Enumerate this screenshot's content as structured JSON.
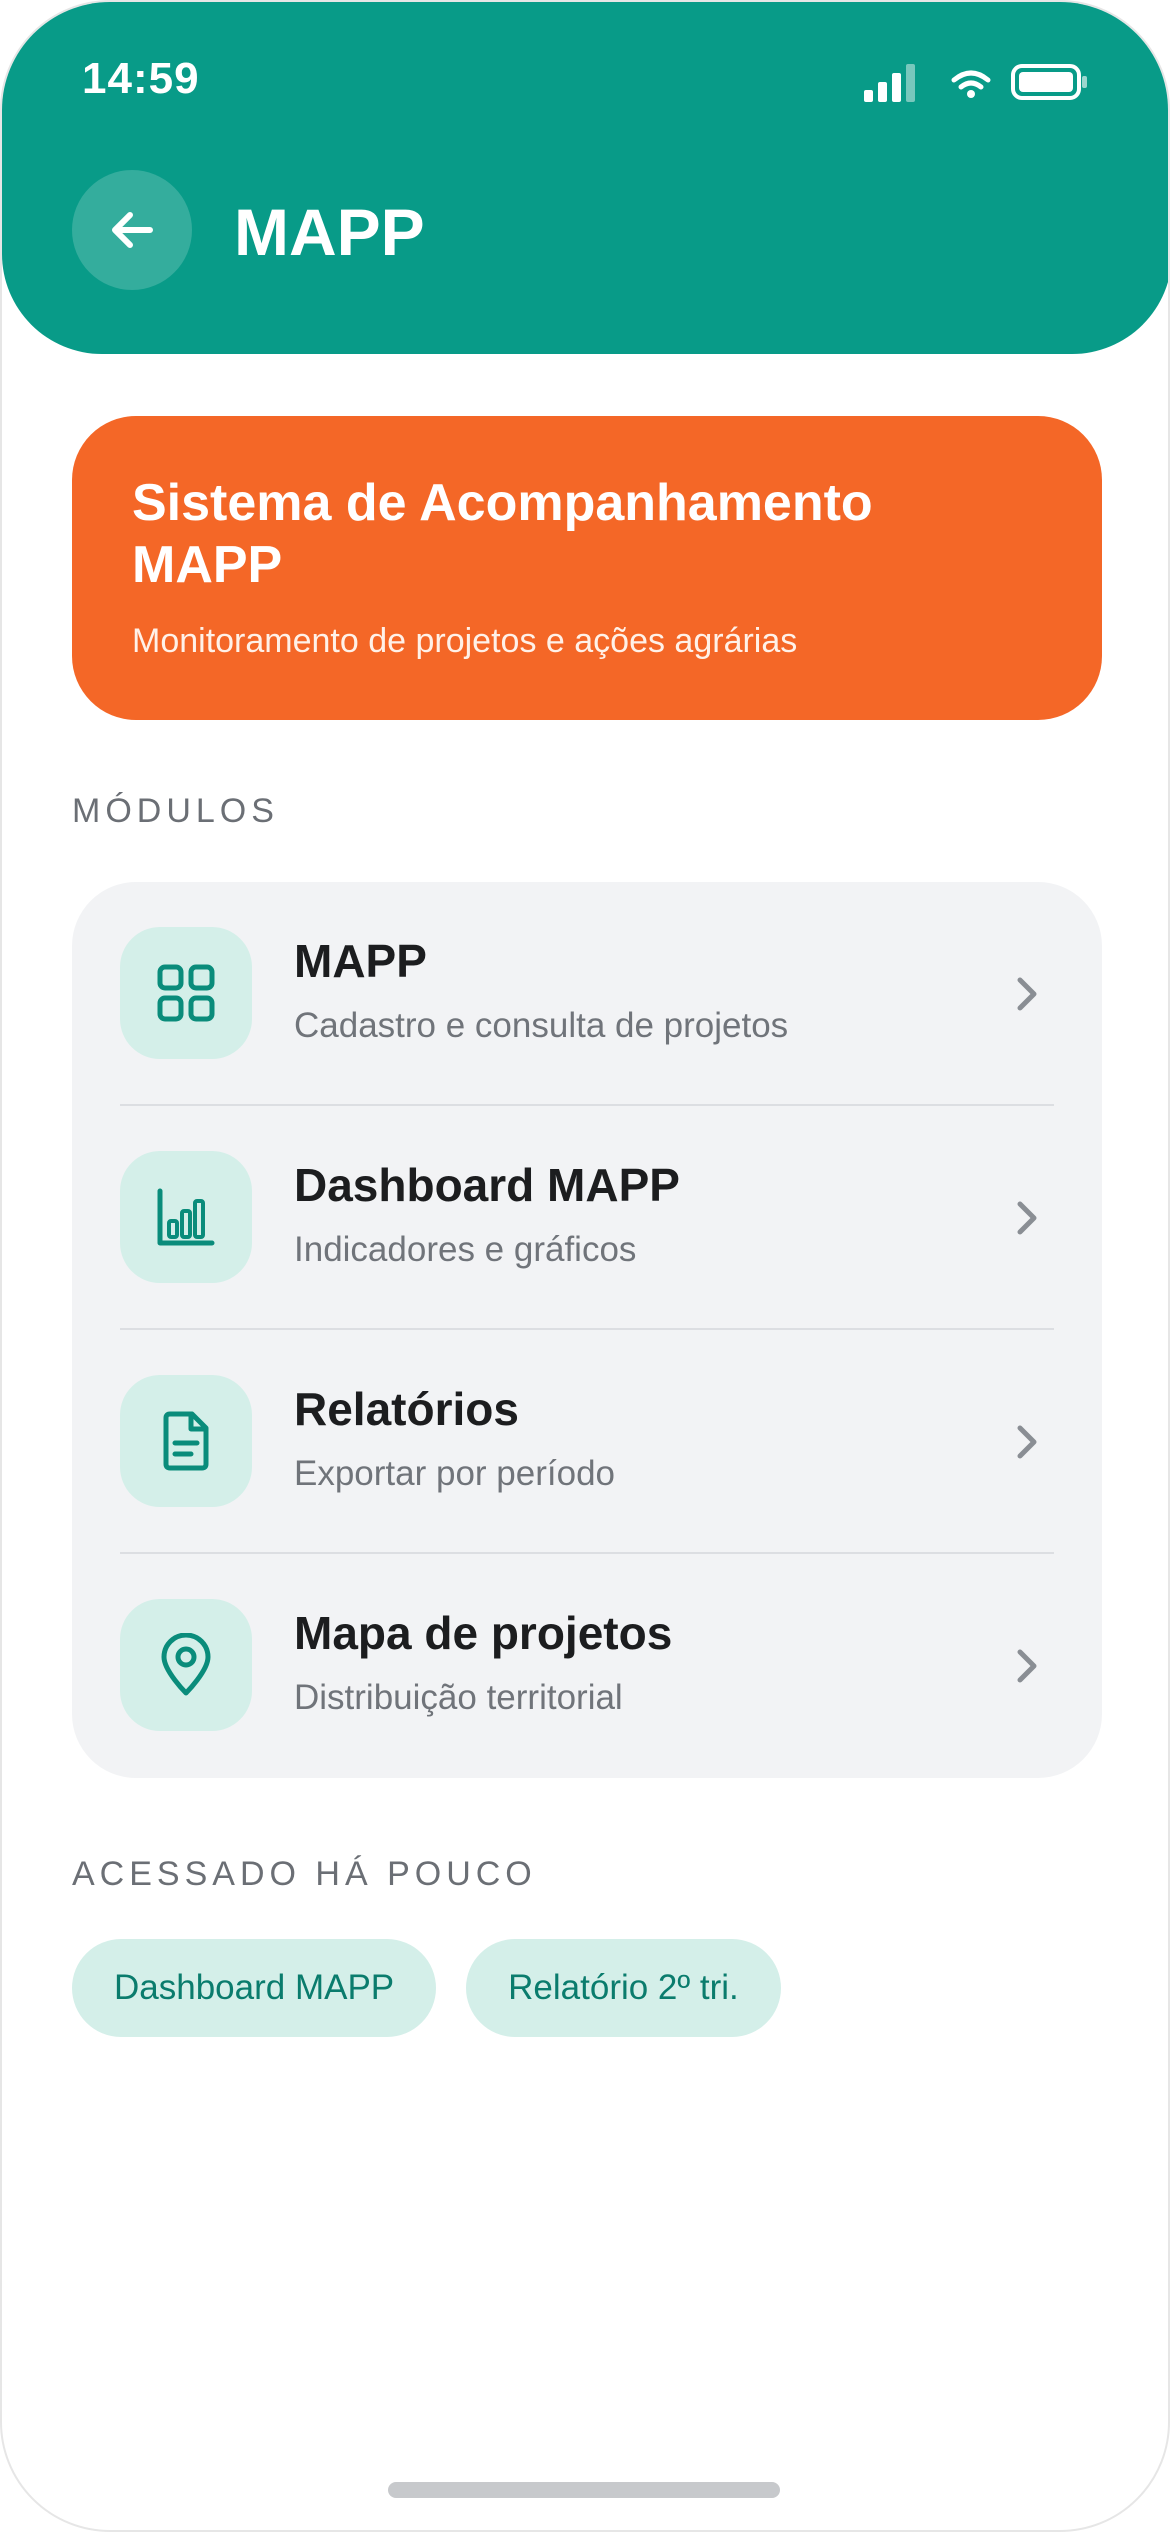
{
  "status_bar": {
    "time": "14:59"
  },
  "header": {
    "title": "MAPP",
    "accent_color": "#089b88"
  },
  "hero": {
    "title": "Sistema de Acompanhamento MAPP",
    "subtitle": "Monitoramento de projetos e ações agrárias",
    "color": "#f46727"
  },
  "modules": {
    "section_label": "MÓDULOS",
    "items": [
      {
        "title": "MAPP",
        "subtitle": "Cadastro e consulta de projetos",
        "icon": "grid-icon"
      },
      {
        "title": "Dashboard MAPP",
        "subtitle": "Indicadores e gráficos",
        "icon": "bar-chart-icon"
      },
      {
        "title": "Relatórios",
        "subtitle": "Exportar por período",
        "icon": "document-icon"
      },
      {
        "title": "Mapa de projetos",
        "subtitle": "Distribuição territorial",
        "icon": "map-pin-icon"
      }
    ]
  },
  "recent": {
    "section_label": "ACESSADO HÁ POUCO",
    "chips": [
      "Dashboard MAPP",
      "Relatório 2º tri."
    ]
  }
}
